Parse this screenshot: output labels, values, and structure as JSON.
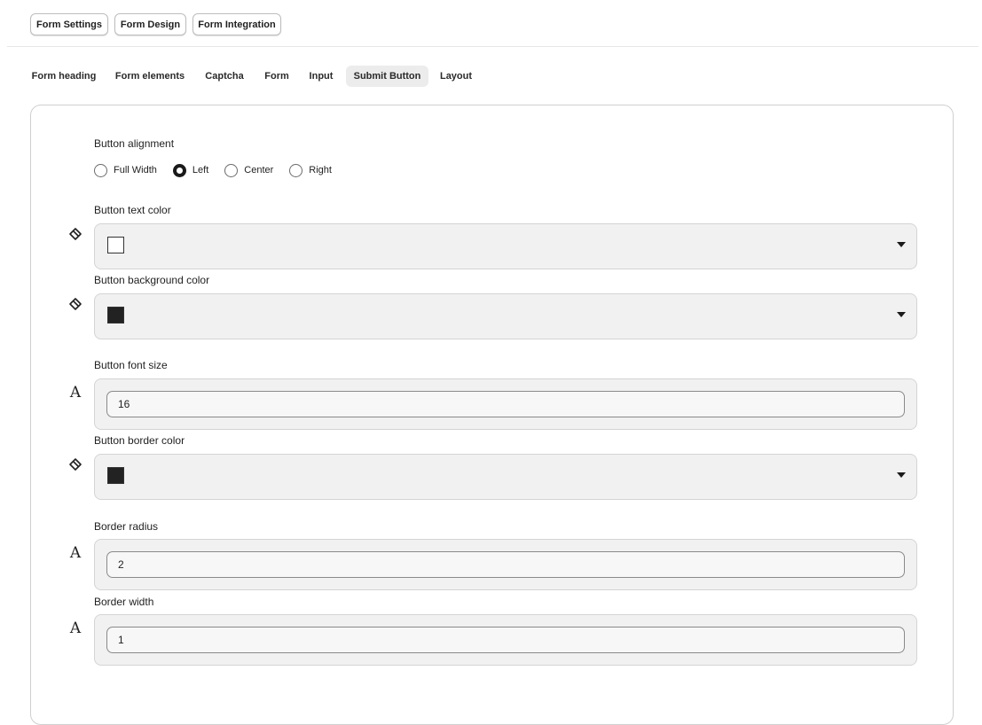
{
  "top_buttons": [
    "Form Settings",
    "Form Design",
    "Form Integration"
  ],
  "tabs": [
    "Form heading",
    "Form elements",
    "Captcha",
    "Form",
    "Input",
    "Submit Button",
    "Layout"
  ],
  "active_tab": "Submit Button",
  "fields": {
    "alignment": {
      "label": "Button alignment",
      "options": [
        "Full Width",
        "Left",
        "Center",
        "Right"
      ],
      "selected": "Left"
    },
    "text_color": {
      "label": "Button text color",
      "value": "#ffffff",
      "icon": "paint-bucket-icon"
    },
    "background_color": {
      "label": "Button background color",
      "value": "#222222",
      "icon": "paint-bucket-icon"
    },
    "font_size": {
      "label": "Button font size",
      "value": "16",
      "icon": "font-icon"
    },
    "border_color": {
      "label": "Button border color",
      "value": "#222222",
      "icon": "paint-bucket-icon"
    },
    "border_radius": {
      "label": "Border radius",
      "value": "2",
      "icon": "font-icon"
    },
    "border_width": {
      "label": "Border width",
      "value": "1",
      "icon": "font-icon"
    }
  },
  "icons": {
    "font_glyph": "A"
  }
}
